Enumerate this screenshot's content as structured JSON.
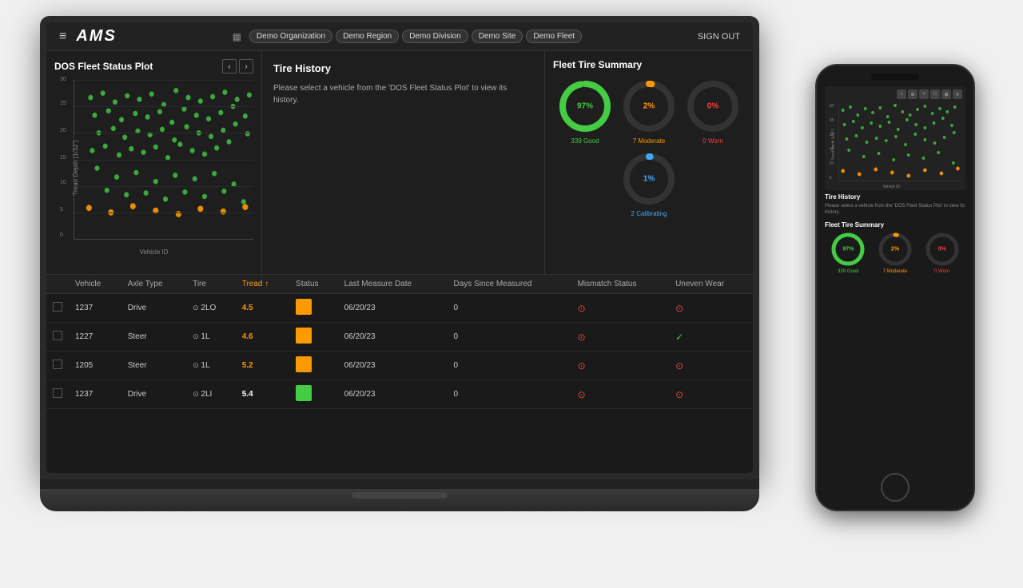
{
  "header": {
    "menu_icon": "≡",
    "logo": "AMS",
    "breadcrumb_icon": "▦",
    "breadcrumbs": [
      "Demo Organization",
      "Demo Region",
      "Demo Division",
      "Demo Site",
      "Demo Fleet"
    ],
    "sign_out": "SIGN OUT"
  },
  "dos_panel": {
    "title": "DOS Fleet Status Plot",
    "prev_label": "‹",
    "next_label": "›",
    "y_label": "Tread Depth [1/32\"]",
    "x_label": "Vehicle ID",
    "y_ticks": [
      "30",
      "25",
      "20",
      "15",
      "10",
      "5",
      "0"
    ]
  },
  "tire_history": {
    "title": "Tire History",
    "description": "Please select a vehicle from the 'DOS Fleet Status Plot' to view its history."
  },
  "fleet_summary": {
    "title": "Fleet Tire Summary",
    "donuts": [
      {
        "pct": 97,
        "label": "339 Good",
        "color": "#4c4",
        "track_color": "#333"
      },
      {
        "pct": 2,
        "label": "7 Moderate",
        "color": "#f90",
        "track_color": "#333"
      },
      {
        "pct": 0,
        "label": "0 Worn",
        "color": "#e44",
        "track_color": "#333"
      }
    ],
    "donut_calibrating": {
      "pct": 1,
      "label": "2 Calibrating",
      "color": "#4af",
      "track_color": "#333"
    }
  },
  "table": {
    "columns": [
      "",
      "Vehicle",
      "Axle Type",
      "Tire",
      "Tread ↑",
      "Status",
      "Last Measure Date",
      "Days Since Measured",
      "Mismatch Status",
      "Uneven Wear"
    ],
    "rows": [
      {
        "vehicle": "1237",
        "axle": "Drive",
        "tire": "⊙ 2LO",
        "tread": "4.5",
        "status": "orange",
        "date": "06/20/23",
        "days": "0",
        "mismatch": "warn",
        "uneven": "warn"
      },
      {
        "vehicle": "1227",
        "axle": "Steer",
        "tire": "⊙ 1L",
        "tread": "4.6",
        "status": "orange",
        "date": "06/20/23",
        "days": "0",
        "mismatch": "warn",
        "uneven": "check"
      },
      {
        "vehicle": "1205",
        "axle": "Steer",
        "tire": "⊙ 1L",
        "tread": "5.2",
        "status": "orange",
        "date": "06/20/23",
        "days": "0",
        "mismatch": "warn",
        "uneven": "warn"
      },
      {
        "vehicle": "1237",
        "axle": "Drive",
        "tire": "⊙ 2LI",
        "tread": "5.4",
        "status": "green",
        "date": "06/20/23",
        "days": "0",
        "mismatch": "warn",
        "uneven": "warn"
      }
    ]
  },
  "phone": {
    "chart_title": "",
    "tire_history_title": "Tire History",
    "tire_history_desc": "Please select a vehicle from the 'DOS Fleet Status Plot' to view its history.",
    "fleet_summary_title": "Fleet Tire Summary",
    "phone_donuts": [
      {
        "pct": 97,
        "label": "339 Good",
        "color": "#4c4"
      },
      {
        "pct": 2,
        "label": "7 Moderate",
        "color": "#f90"
      },
      {
        "pct": 0,
        "label": "0 Worn",
        "color": "#e44"
      }
    ]
  },
  "colors": {
    "bg_dark": "#1a1a1a",
    "bg_panel": "#1e1e1e",
    "bg_header": "#222",
    "border": "#333",
    "text_primary": "#fff",
    "text_secondary": "#aaa",
    "green": "#4c4",
    "orange": "#f90",
    "red": "#e44",
    "blue": "#4af"
  }
}
